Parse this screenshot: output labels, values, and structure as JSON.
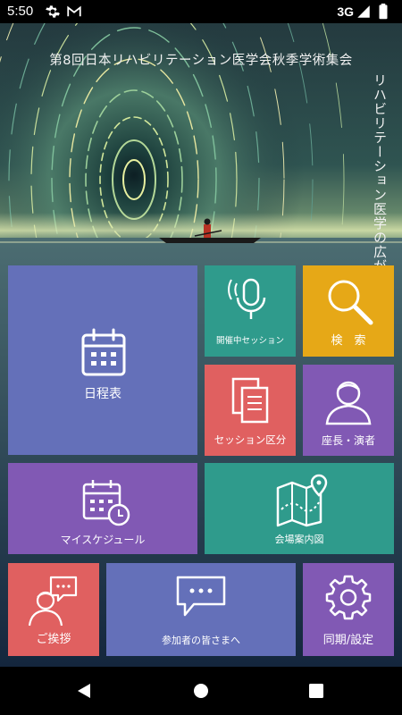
{
  "status_bar": {
    "time": "5:50",
    "network": "3G"
  },
  "hero": {
    "title": "第8回日本リハビリテーション医学会秋季学術集会",
    "subtitle": "リハビリテーション医学の広がり"
  },
  "tiles": {
    "schedule": "日程表",
    "live_session": "開催中セッション",
    "search": "検　索",
    "session_category": "セッション区分",
    "chairs_speakers": "座長・演者",
    "my_schedule": "マイスケジュール",
    "venue_map": "会場案内図",
    "greeting": "ご挨拶",
    "to_participants": "参加者の皆さまへ",
    "sync_settings": "同期/設定"
  },
  "colors": {
    "indigo": "#6470b9",
    "teal": "#2f9b8c",
    "amber": "#e6a817",
    "coral": "#e06060",
    "purple": "#8159b4"
  }
}
